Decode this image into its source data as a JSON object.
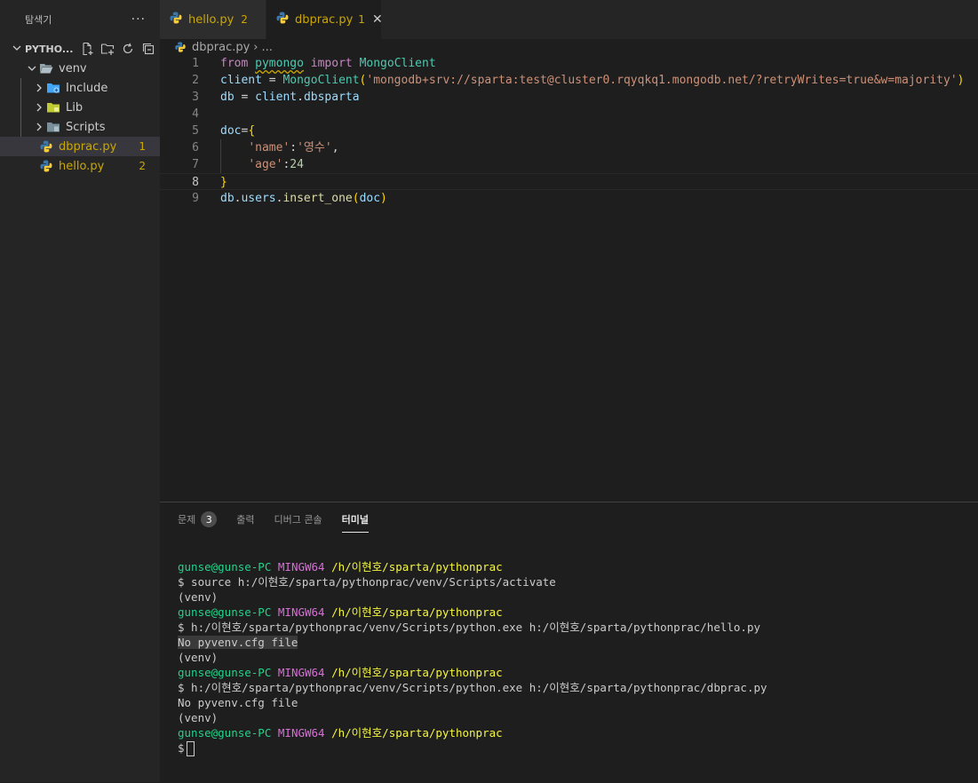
{
  "sidebar": {
    "title": "탐색기",
    "more": "···",
    "project": "PYTHO...",
    "tree": [
      {
        "label": "venv",
        "type": "folder-open",
        "indent": 1
      },
      {
        "label": "Include",
        "type": "folder",
        "indent": 2
      },
      {
        "label": "Lib",
        "type": "folder",
        "indent": 2
      },
      {
        "label": "Scripts",
        "type": "folder",
        "indent": 2
      },
      {
        "label": "dbprac.py",
        "type": "python",
        "indent": 1,
        "badge": "1",
        "selected": true
      },
      {
        "label": "hello.py",
        "type": "python",
        "indent": 1,
        "badge": "2"
      }
    ]
  },
  "tabs": [
    {
      "label": "hello.py",
      "count": "2",
      "active": false
    },
    {
      "label": "dbprac.py",
      "count": "1",
      "active": true,
      "close": "✕"
    }
  ],
  "breadcrumb": {
    "file": "dbprac.py",
    "sep": "›",
    "rest": "..."
  },
  "editor": {
    "line_numbers": [
      "1",
      "2",
      "3",
      "4",
      "5",
      "6",
      "7",
      "8",
      "9"
    ],
    "current_line": 8
  },
  "panel": {
    "tabs": [
      {
        "label": "문제",
        "badge": "3"
      },
      {
        "label": "출력"
      },
      {
        "label": "디버그 콘솔"
      },
      {
        "label": "터미널",
        "active": true
      }
    ],
    "prompt": {
      "user": "gunse@gunse-PC",
      "sys": "MINGW64",
      "path": "/h/이현호/sparta/pythonprac"
    },
    "terminal_lines": {
      "cmd1": "$ source h:/이현호/sparta/pythonprac/venv/Scripts/activate",
      "venv": "(venv)",
      "cmd2": "$ h:/이현호/sparta/pythonprac/venv/Scripts/python.exe h:/이현호/sparta/pythonprac/hello.py",
      "out": "No pyvenv.cfg file",
      "cmd3": "$ h:/이현호/sparta/pythonprac/venv/Scripts/python.exe h:/이현호/sparta/pythonprac/dbprac.py",
      "prompt_end": "$"
    }
  },
  "colors": {
    "accent": "#cca700",
    "bg": "#1e1e1e",
    "sidebar": "#252526"
  }
}
